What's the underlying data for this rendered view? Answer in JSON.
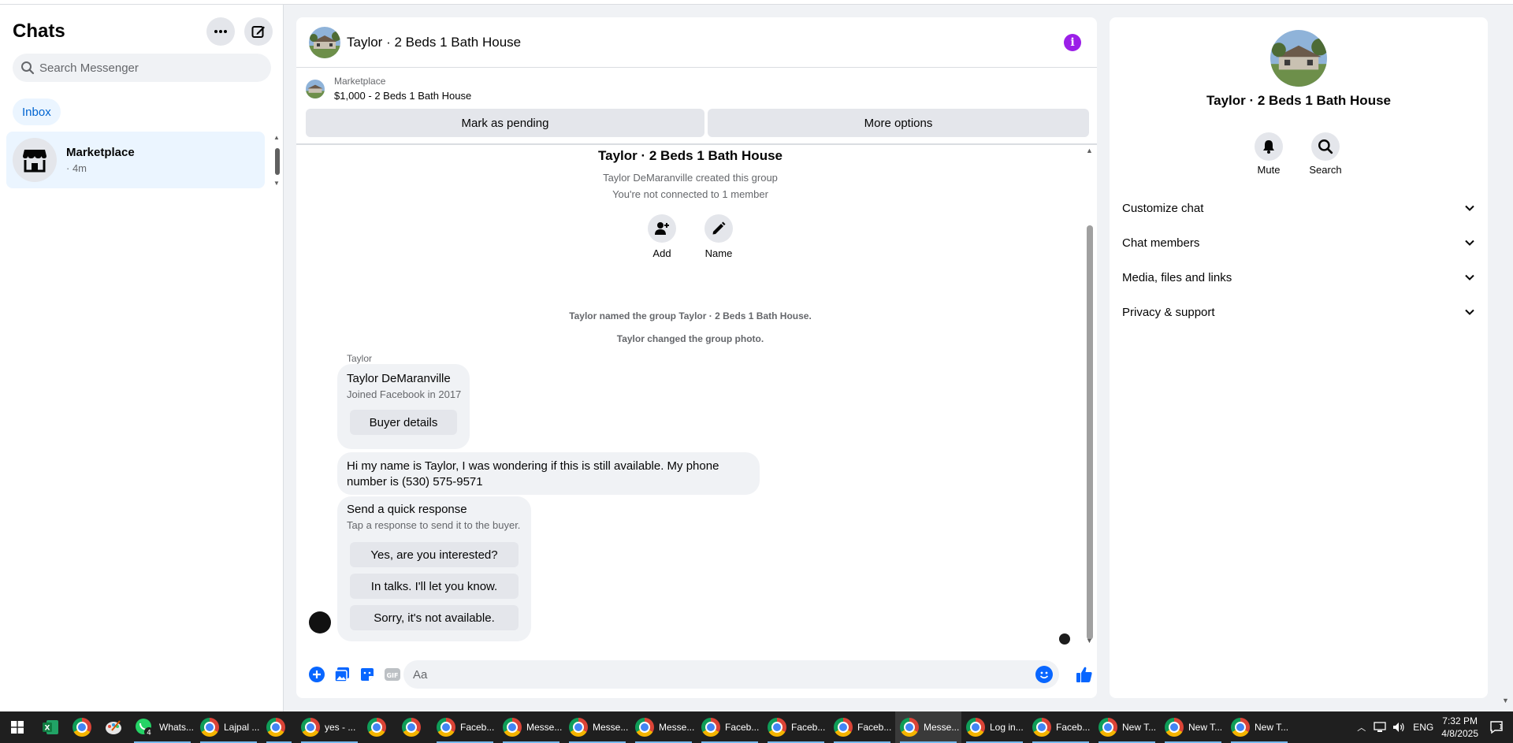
{
  "sidebar": {
    "title": "Chats",
    "search_placeholder": "Search Messenger",
    "inbox_label": "Inbox",
    "conversation": {
      "name": "Marketplace",
      "time": "· 4m"
    }
  },
  "chat": {
    "title": "Taylor · 2 Beds 1 Bath House",
    "listing": {
      "label": "Marketplace",
      "title": "$1,000 - 2 Beds 1 Bath House"
    },
    "actions": {
      "pending": "Mark as pending",
      "more": "More options"
    },
    "group": {
      "title": "Taylor · 2 Beds 1 Bath House",
      "created": "Taylor DeMaranville created this group",
      "not_connected": "You're not connected to 1 member",
      "add_label": "Add",
      "name_label": "Name"
    },
    "system_messages": [
      "Taylor named the group Taylor · 2 Beds 1 Bath House.",
      "Taylor changed the group photo."
    ],
    "sender": "Taylor",
    "buyer_card": {
      "name": "Taylor DeMaranville",
      "joined": "Joined Facebook in 2017",
      "button": "Buyer details"
    },
    "message": "Hi my name is Taylor, I was wondering if this is still available. My phone number is (530) 575-9571",
    "quick_response": {
      "title": "Send a quick response",
      "subtitle": "Tap a response to send it to the buyer.",
      "options": [
        "Yes, are you interested?",
        "In talks. I'll let you know.",
        "Sorry, it's not available."
      ]
    },
    "composer_placeholder": "Aa"
  },
  "right_panel": {
    "name": "Taylor · 2 Beds 1 Bath House",
    "mute_label": "Mute",
    "search_label": "Search",
    "sections": [
      "Customize chat",
      "Chat members",
      "Media, files and links",
      "Privacy & support"
    ]
  },
  "taskbar": {
    "items": [
      {
        "label": "Whats...",
        "active": false
      },
      {
        "label": "Lajpal ...",
        "active": false
      },
      {
        "label": "",
        "active": false
      },
      {
        "label": "yes - ...",
        "active": false
      },
      {
        "label": "",
        "active": false
      },
      {
        "label": "",
        "active": false
      },
      {
        "label": "Faceb...",
        "active": false
      },
      {
        "label": "Messe...",
        "active": false
      },
      {
        "label": "Messe...",
        "active": false
      },
      {
        "label": "Messe...",
        "active": false
      },
      {
        "label": "Faceb...",
        "active": false
      },
      {
        "label": "Faceb...",
        "active": false
      },
      {
        "label": "Faceb...",
        "active": false
      },
      {
        "label": "Messe...",
        "active": true
      },
      {
        "label": "Log in...",
        "active": false
      },
      {
        "label": "Faceb...",
        "active": false
      },
      {
        "label": "New T...",
        "active": false
      },
      {
        "label": "New T...",
        "active": false
      },
      {
        "label": "New T...",
        "active": false
      }
    ],
    "whatsapp_badge": "4",
    "language": "ENG",
    "time": "7:32 PM",
    "date": "4/8/2025"
  },
  "colors": {
    "accent": "#0866ff",
    "info": "#9b1fe8",
    "selected_bg": "#ebf5ff"
  }
}
